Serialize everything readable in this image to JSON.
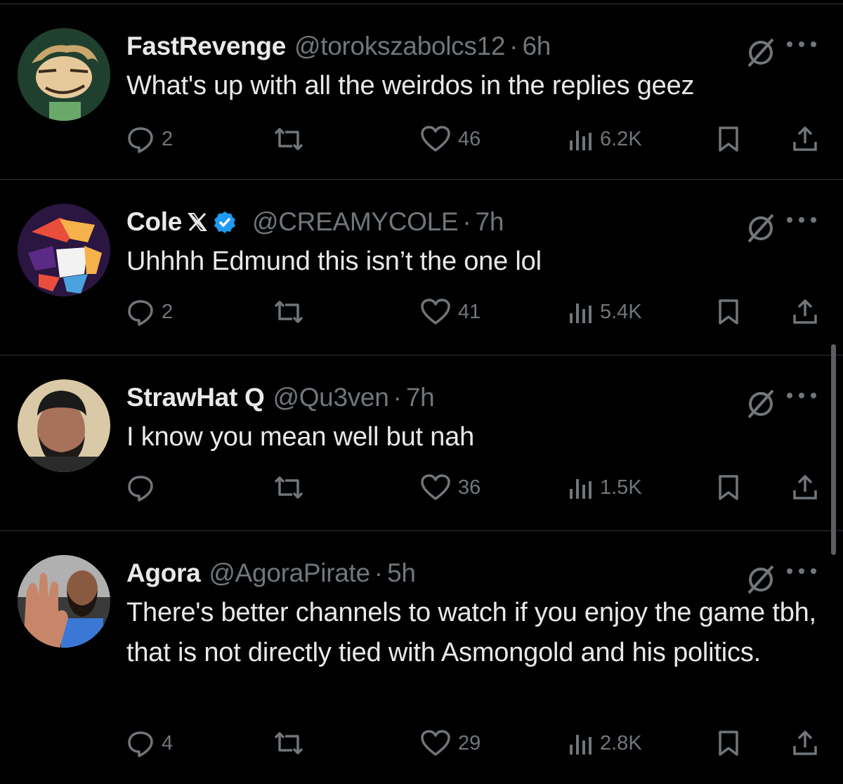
{
  "tweets": [
    {
      "name": "FastRevenge",
      "handle": "@torokszabolcs12",
      "time": "6h",
      "text": "What's up with all the weirdos in the replies geez",
      "replies": "2",
      "likes": "46",
      "views": "6.2K",
      "verified": false,
      "x_badge": false
    },
    {
      "name": "Cole",
      "handle": "@CREAMYCOLE",
      "time": "7h",
      "text": "Uhhhh Edmund this isn’t the one lol",
      "replies": "2",
      "likes": "41",
      "views": "5.4K",
      "verified": true,
      "x_badge": true
    },
    {
      "name": "StrawHat Q",
      "handle": "@Qu3ven",
      "time": "7h",
      "text": "I know you mean well but nah",
      "replies": "",
      "likes": "36",
      "views": "1.5K",
      "verified": false,
      "x_badge": false
    },
    {
      "name": "Agora",
      "handle": "@AgoraPirate",
      "time": "5h",
      "text": "There's better channels to watch if you enjoy the game tbh, that is not directly tied with Asmongold and his politics.",
      "replies": "4",
      "likes": "29",
      "views": "2.8K",
      "verified": false,
      "x_badge": false
    }
  ],
  "dot_separator": "·",
  "icons": {
    "reply": "reply-bubble-icon",
    "retweet": "retweet-icon",
    "like": "heart-icon",
    "views": "views-bar-chart-icon",
    "bookmark": "bookmark-icon",
    "share": "share-upload-icon",
    "grok": "grok-slash-icon",
    "more": "more-dots-icon"
  },
  "colors": {
    "background": "#000000",
    "text": "#e7e9ea",
    "secondary": "#71767b",
    "divider": "#2f3336",
    "verified": "#1d9bf0"
  }
}
